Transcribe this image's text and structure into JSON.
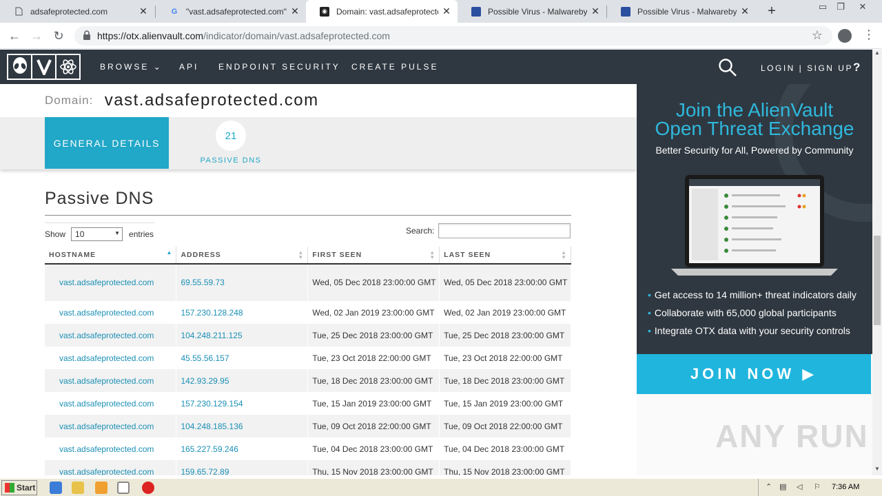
{
  "browser": {
    "tabs": [
      {
        "title": "adsafeprotected.com",
        "icon": "page-icon"
      },
      {
        "title": "\"vast.adsafeprotected.com\" - G",
        "icon": "google-icon"
      },
      {
        "title": "Domain: vast.adsafeprotected.c",
        "icon": "alienvault-icon"
      },
      {
        "title": "Possible Virus - Malwarebytes N",
        "icon": "malwarebytes-icon"
      },
      {
        "title": "Possible Virus - Malwarebytes N",
        "icon": "malwarebytes-icon"
      }
    ],
    "url_host": "https://otx.alienvault.com",
    "url_path": "/indicator/domain/vast.adsafeprotected.com"
  },
  "sitenav": {
    "links": [
      "BROWSE",
      "API",
      "ENDPOINT SECURITY",
      "CREATE PULSE"
    ],
    "login": "LOGIN | SIGN UP",
    "help": "?"
  },
  "indicator": {
    "label": "Domain:",
    "value": "vast.adsafeprotected.com"
  },
  "tabs": {
    "general": "GENERAL DETAILS",
    "passive_count": "21",
    "passive_label": "PASSIVE DNS"
  },
  "section": {
    "title": "Passive DNS",
    "show": "Show",
    "entries_value": "10",
    "entries": "entries",
    "search": "Search:"
  },
  "table": {
    "headers": [
      "HOSTNAME",
      "ADDRESS",
      "FIRST SEEN",
      "LAST SEEN"
    ],
    "rows": [
      {
        "host": "vast.adsafeprotected.com",
        "address": "69.55.59.73",
        "first": "Wed, 05 Dec 2018 23:00:00 GMT",
        "last": "Wed, 05 Dec 2018 23:00:00 GMT"
      },
      {
        "host": "vast.adsafeprotected.com",
        "address": "157.230.128.248",
        "first": "Wed, 02 Jan 2019 23:00:00 GMT",
        "last": "Wed, 02 Jan 2019 23:00:00 GMT"
      },
      {
        "host": "vast.adsafeprotected.com",
        "address": "104.248.211.125",
        "first": "Tue, 25 Dec 2018 23:00:00 GMT",
        "last": "Tue, 25 Dec 2018 23:00:00 GMT"
      },
      {
        "host": "vast.adsafeprotected.com",
        "address": "45.55.56.157",
        "first": "Tue, 23 Oct 2018 22:00:00 GMT",
        "last": "Tue, 23 Oct 2018 22:00:00 GMT"
      },
      {
        "host": "vast.adsafeprotected.com",
        "address": "142.93.29.95",
        "first": "Tue, 18 Dec 2018 23:00:00 GMT",
        "last": "Tue, 18 Dec 2018 23:00:00 GMT"
      },
      {
        "host": "vast.adsafeprotected.com",
        "address": "157.230.129.154",
        "first": "Tue, 15 Jan 2019 23:00:00 GMT",
        "last": "Tue, 15 Jan 2019 23:00:00 GMT"
      },
      {
        "host": "vast.adsafeprotected.com",
        "address": "104.248.185.136",
        "first": "Tue, 09 Oct 2018 22:00:00 GMT",
        "last": "Tue, 09 Oct 2018 22:00:00 GMT"
      },
      {
        "host": "vast.adsafeprotected.com",
        "address": "165.227.59.246",
        "first": "Tue, 04 Dec 2018 23:00:00 GMT",
        "last": "Tue, 04 Dec 2018 23:00:00 GMT"
      },
      {
        "host": "vast.adsafeprotected.com",
        "address": "159.65.72.89",
        "first": "Thu, 15 Nov 2018 23:00:00 GMT",
        "last": "Thu, 15 Nov 2018 23:00:00 GMT"
      }
    ]
  },
  "banner": {
    "title_line1": "Join the AlienVault",
    "title_line2": "Open Threat Exchange",
    "subtitle": "Better Security for All, Powered by Community",
    "bullets": [
      "Get access to 14 million+ threat indicators daily",
      "Collaborate with 65,000 global participants",
      "Integrate OTX data with your security controls"
    ],
    "join": "JOIN NOW ▶",
    "watermark": "ANY RUN"
  },
  "taskbar": {
    "start": "Start",
    "clock": "7:36 AM"
  },
  "colors": {
    "accent": "#21a7c7",
    "nav_bg": "#2f3841",
    "join_bg": "#1fb5dd"
  }
}
